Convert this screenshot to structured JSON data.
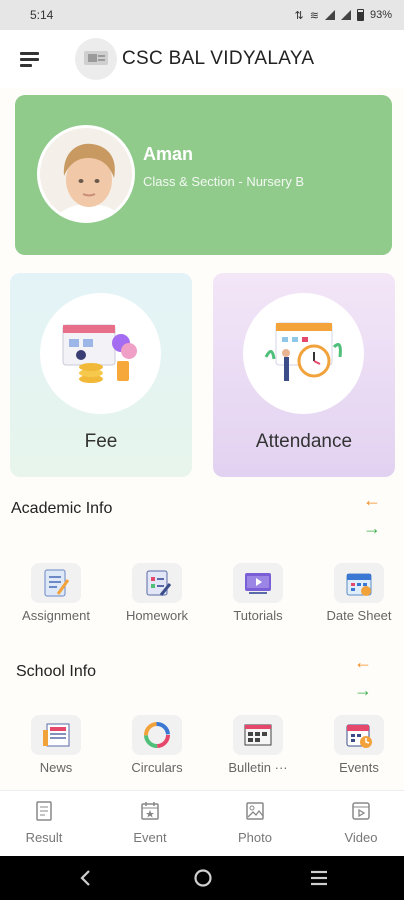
{
  "status_bar": {
    "time": "5:14",
    "battery": "93%"
  },
  "app": {
    "title": "CSC BAL VIDYALAYA",
    "logo_text": "CSC BAL VIDYALAYA"
  },
  "profile": {
    "name": "Aman",
    "class_section": "Class & Section - Nursery B",
    "card_color": "#90cb8c"
  },
  "tiles": [
    {
      "label": "Fee"
    },
    {
      "label": "Attendance"
    }
  ],
  "academic": {
    "title": "Academic Info",
    "items": [
      {
        "label": "Assignment",
        "icon": "assignment-icon"
      },
      {
        "label": "Homework",
        "icon": "homework-icon"
      },
      {
        "label": "Tutorials",
        "icon": "tutorials-icon"
      },
      {
        "label": "Date Sheet",
        "icon": "date-sheet-icon"
      }
    ]
  },
  "school": {
    "title": "School Info",
    "items": [
      {
        "label": "News",
        "icon": "news-icon"
      },
      {
        "label": "Circulars",
        "icon": "circulars-icon"
      },
      {
        "label": "Bulletin ···",
        "icon": "bulletin-icon"
      },
      {
        "label": "Events",
        "icon": "events-icon"
      }
    ]
  },
  "bottom_nav": [
    {
      "label": "Result",
      "icon": "result-icon"
    },
    {
      "label": "Event",
      "icon": "event-icon"
    },
    {
      "label": "Photo",
      "icon": "photo-icon"
    },
    {
      "label": "Video",
      "icon": "video-icon"
    }
  ],
  "colors": {
    "arrow_left": "#f08b1f",
    "arrow_right": "#3fae4e",
    "fee_tile": "#e3f3f7",
    "attendance_tile": "#e8d9f3"
  }
}
